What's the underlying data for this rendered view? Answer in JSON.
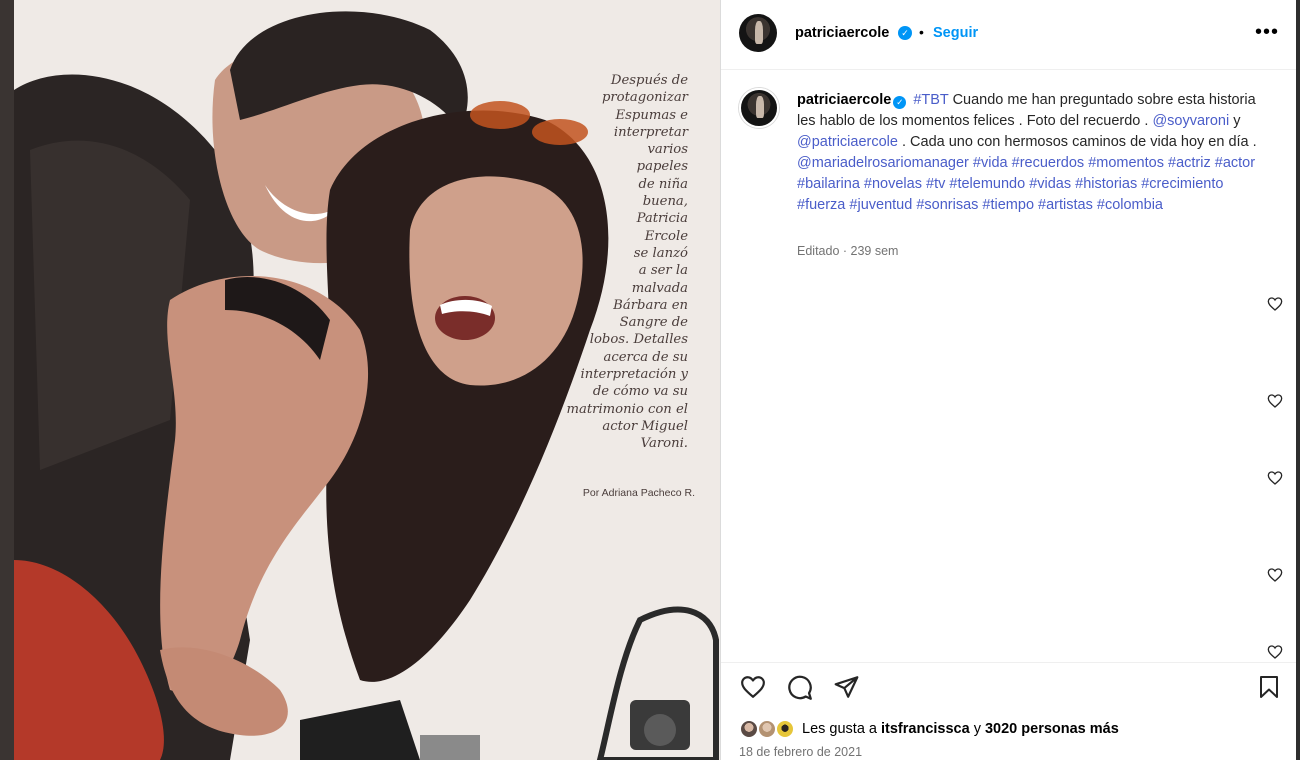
{
  "photo": {
    "alt": "",
    "magazine_text": "Después de\nprotagonizar\nEspumas e\ninterpretar\nvarios\npapeles\nde niña\nbuena,\nPatricia\nErcole\nse lanzó\na ser la\nmalvada\nBárbara en\nSangre de\nlobos. Detalles\nacerca de su\ninterpretación y\nde cómo va su\nmatrimonio con el\nactor Miguel\nVaroni.",
    "byline": "Por Adriana Pacheco R."
  },
  "header": {
    "username": "patriciaercole",
    "verified_mark": "✓",
    "separator": "•",
    "follow_label": "Seguir",
    "more_label": "•••"
  },
  "caption": {
    "username": "patriciaercole",
    "verified_mark": "✓",
    "seg1": "#TBT",
    "seg2": " Cuando me han preguntado sobre esta historia les hablo de los momentos felices . Foto del recuerdo . ",
    "seg3": "@soyvaroni",
    "seg4": " y ",
    "seg5": "@patriciaercole",
    "seg6": " . Cada uno con hermosos caminos de vida hoy en día . ",
    "seg7": "@mariadelrosariomanager",
    "seg8": " ",
    "hashtags": [
      "#vida",
      "#recuerdos",
      "#momentos",
      "#actriz",
      "#actor",
      "#bailarina",
      "#novelas",
      "#tv",
      "#telemundo",
      "#vidas",
      "#historias",
      "#crecimiento",
      "#fuerza",
      "#juventud",
      "#sonrisas",
      "#tiempo",
      "#artistas",
      "#colombia"
    ],
    "meta": "Editado · 239 sem"
  },
  "actions": {
    "like_icon": "heart-icon",
    "comment_icon": "comment-icon",
    "share_icon": "paper-plane-icon",
    "save_icon": "bookmark-icon"
  },
  "likes": {
    "prefix": "Les gusta a ",
    "user": "itsfrancissca",
    "middle": " y ",
    "count_text": "3020 personas más"
  },
  "date": "18 de febrero de 2021",
  "colors": {
    "link": "#4a5dc9",
    "follow": "#0095f6",
    "verified": "#0095f6",
    "secondary_text": "#737373"
  }
}
